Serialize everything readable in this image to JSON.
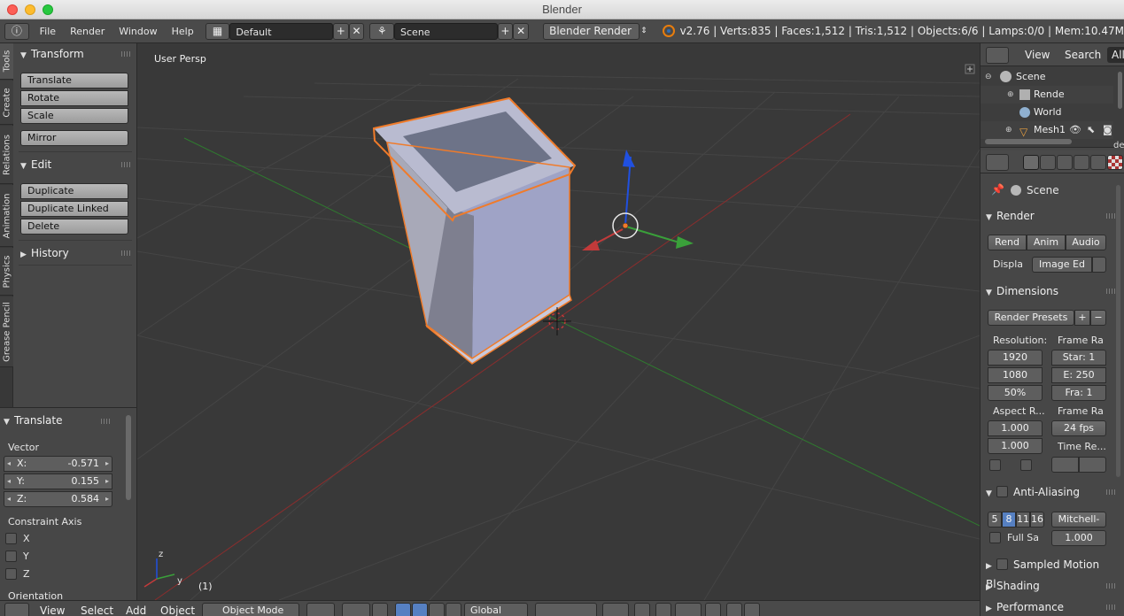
{
  "window": {
    "title": "Blender"
  },
  "info_header": {
    "menus": [
      "File",
      "Render",
      "Window",
      "Help"
    ],
    "layout": "Default",
    "scene": "Scene",
    "engine": "Blender Render",
    "stats": "v2.76 | Verts:835 | Faces:1,512 | Tris:1,512 | Objects:6/6 | Lamps:0/0 | Mem:10.47M"
  },
  "tool_tabs": [
    "Tools",
    "Create",
    "Relations",
    "Animation",
    "Physics",
    "Grease Pencil"
  ],
  "tool_shelf": {
    "transform": {
      "title": "Transform",
      "buttons": [
        "Translate",
        "Rotate",
        "Scale"
      ],
      "mirror": "Mirror"
    },
    "edit": {
      "title": "Edit",
      "buttons": [
        "Duplicate",
        "Duplicate Linked",
        "Delete"
      ]
    },
    "history": {
      "title": "History"
    }
  },
  "operator_panel": {
    "title": "Translate",
    "vector_label": "Vector",
    "x": {
      "label": "X:",
      "value": "-0.571"
    },
    "y": {
      "label": "Y:",
      "value": "0.155"
    },
    "z": {
      "label": "Z:",
      "value": "0.584"
    },
    "constraint_label": "Constraint Axis",
    "axes": [
      "X",
      "Y",
      "Z"
    ],
    "orientation_label": "Orientation"
  },
  "viewport": {
    "view_label": "User Persp",
    "frame": "(1)",
    "axis_z": "z",
    "axis_y": "y"
  },
  "view3d_header": {
    "menus": [
      "View",
      "Select",
      "Add",
      "Object"
    ],
    "mode": "Object Mode",
    "orientation": "Global"
  },
  "outliner": {
    "menus": [
      "View",
      "Search",
      "All"
    ],
    "rows": [
      "Scene",
      "Rende",
      "World",
      "Mesh1"
    ],
    "cut": "de"
  },
  "properties": {
    "context": "Scene",
    "render": {
      "title": "Render",
      "buttons": [
        "Rend",
        "Anim",
        "Audio"
      ],
      "display_label": "Displa",
      "display_value": "Image Ed"
    },
    "dimensions": {
      "title": "Dimensions",
      "presets": "Render Presets",
      "resolution_label": "Resolution:",
      "res_x": "1920",
      "res_y": "1080",
      "res_pct": "50%",
      "frame_range_label": "Frame Ra",
      "start": "Star: 1",
      "end": "E: 250",
      "step": "Fra: 1",
      "aspect_label": "Aspect R...",
      "aspect_x": "1.000",
      "aspect_y": "1.000",
      "frame_rate_label": "Frame Ra",
      "fps": "24 fps",
      "time_remap_label": "Time Re..."
    },
    "anti_aliasing": {
      "title": "Anti-Aliasing",
      "samples": [
        "5",
        "8",
        "11",
        "16"
      ],
      "filter": "Mitchell-",
      "full_sample_label": "Full Sa",
      "filter_size": "1.000"
    },
    "sampled_motion": {
      "title": "Sampled Motion Bl"
    },
    "shading": {
      "title": "Shading"
    },
    "performance": {
      "title": "Performance"
    }
  },
  "colors": {
    "selection_outline": "#f07b2a",
    "x_axis": "#c23a3a",
    "y_axis": "#3aa03a",
    "z_axis": "#2050e0",
    "active_button": "#5680c2"
  }
}
